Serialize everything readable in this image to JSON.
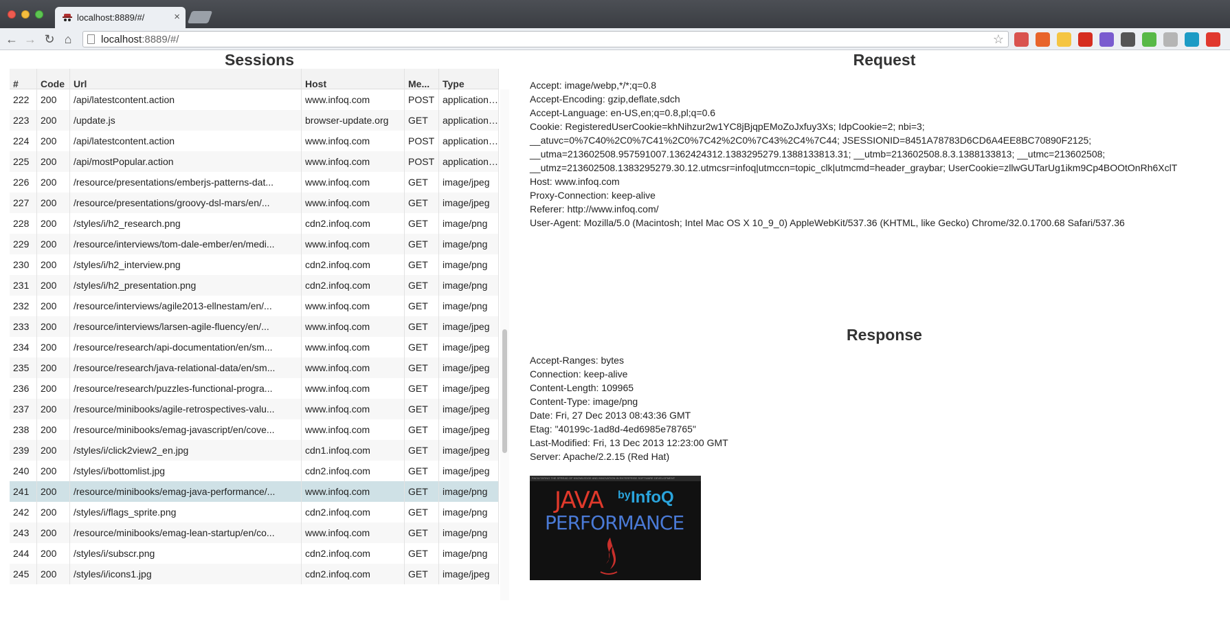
{
  "browser": {
    "tab_title": "localhost:8889/#/",
    "tab_close": "×",
    "url_host": "localhost",
    "url_rest": ":8889/#/",
    "back": "←",
    "forward": "→",
    "reload": "↻",
    "home": "⌂",
    "star": "☆",
    "extensions": [
      {
        "name": "bookmark-ext-icon",
        "color": "#d9534f"
      },
      {
        "name": "firebug-ext-icon",
        "color": "#e8642b"
      },
      {
        "name": "star-ext-icon",
        "color": "#f5c542"
      },
      {
        "name": "power-ext-icon",
        "color": "#d62d20"
      },
      {
        "name": "grid-ext-icon",
        "color": "#7a5ccf"
      },
      {
        "name": "pocket-ext-icon",
        "color": "#555555"
      },
      {
        "name": "evernote-ext-icon",
        "color": "#58b947"
      },
      {
        "name": "android-ext-icon",
        "color": "#b5b5b5"
      },
      {
        "name": "feed-ext-icon",
        "color": "#1d9bc5"
      },
      {
        "name": "adblock-ext-icon",
        "color": "#e0382e"
      }
    ]
  },
  "sessions": {
    "title": "Sessions",
    "columns": [
      "#",
      "Code",
      "Url",
      "Host",
      "Me...",
      "Type"
    ],
    "selected": "241",
    "rows": [
      [
        "222",
        "200",
        "/api/latestcontent.action",
        "www.infoq.com",
        "POST",
        "application/..."
      ],
      [
        "223",
        "200",
        "/update.js",
        "browser-update.org",
        "GET",
        "application/..."
      ],
      [
        "224",
        "200",
        "/api/latestcontent.action",
        "www.infoq.com",
        "POST",
        "application/..."
      ],
      [
        "225",
        "200",
        "/api/mostPopular.action",
        "www.infoq.com",
        "POST",
        "application/..."
      ],
      [
        "226",
        "200",
        "/resource/presentations/emberjs-patterns-dat...",
        "www.infoq.com",
        "GET",
        "image/jpeg"
      ],
      [
        "227",
        "200",
        "/resource/presentations/groovy-dsl-mars/en/...",
        "www.infoq.com",
        "GET",
        "image/jpeg"
      ],
      [
        "228",
        "200",
        "/styles/i/h2_research.png",
        "cdn2.infoq.com",
        "GET",
        "image/png"
      ],
      [
        "229",
        "200",
        "/resource/interviews/tom-dale-ember/en/medi...",
        "www.infoq.com",
        "GET",
        "image/png"
      ],
      [
        "230",
        "200",
        "/styles/i/h2_interview.png",
        "cdn2.infoq.com",
        "GET",
        "image/png"
      ],
      [
        "231",
        "200",
        "/styles/i/h2_presentation.png",
        "cdn2.infoq.com",
        "GET",
        "image/png"
      ],
      [
        "232",
        "200",
        "/resource/interviews/agile2013-ellnestam/en/...",
        "www.infoq.com",
        "GET",
        "image/png"
      ],
      [
        "233",
        "200",
        "/resource/interviews/larsen-agile-fluency/en/...",
        "www.infoq.com",
        "GET",
        "image/jpeg"
      ],
      [
        "234",
        "200",
        "/resource/research/api-documentation/en/sm...",
        "www.infoq.com",
        "GET",
        "image/jpeg"
      ],
      [
        "235",
        "200",
        "/resource/research/java-relational-data/en/sm...",
        "www.infoq.com",
        "GET",
        "image/jpeg"
      ],
      [
        "236",
        "200",
        "/resource/research/puzzles-functional-progra...",
        "www.infoq.com",
        "GET",
        "image/jpeg"
      ],
      [
        "237",
        "200",
        "/resource/minibooks/agile-retrospectives-valu...",
        "www.infoq.com",
        "GET",
        "image/jpeg"
      ],
      [
        "238",
        "200",
        "/resource/minibooks/emag-javascript/en/cove...",
        "www.infoq.com",
        "GET",
        "image/jpeg"
      ],
      [
        "239",
        "200",
        "/styles/i/click2view2_en.jpg",
        "cdn1.infoq.com",
        "GET",
        "image/jpeg"
      ],
      [
        "240",
        "200",
        "/styles/i/bottomlist.jpg",
        "cdn2.infoq.com",
        "GET",
        "image/jpeg"
      ],
      [
        "241",
        "200",
        "/resource/minibooks/emag-java-performance/...",
        "www.infoq.com",
        "GET",
        "image/png"
      ],
      [
        "242",
        "200",
        "/styles/i/flags_sprite.png",
        "cdn2.infoq.com",
        "GET",
        "image/png"
      ],
      [
        "243",
        "200",
        "/resource/minibooks/emag-lean-startup/en/co...",
        "www.infoq.com",
        "GET",
        "image/png"
      ],
      [
        "244",
        "200",
        "/styles/i/subscr.png",
        "cdn2.infoq.com",
        "GET",
        "image/png"
      ],
      [
        "245",
        "200",
        "/styles/i/icons1.jpg",
        "cdn2.infoq.com",
        "GET",
        "image/jpeg"
      ]
    ]
  },
  "request": {
    "title": "Request",
    "headers": [
      "Accept: image/webp,*/*;q=0.8",
      "Accept-Encoding: gzip,deflate,sdch",
      "Accept-Language: en-US,en;q=0.8,pl;q=0.6",
      "Cookie: RegisteredUserCookie=khNihzur2w1YC8jBjqpEMoZoJxfuy3Xs; IdpCookie=2; nbi=3;",
      "__atuvc=0%7C40%2C0%7C41%2C0%7C42%2C0%7C43%2C4%7C44; JSESSIONID=8451A78783D6CD6A4EE8BC70890F2125;",
      "__utma=213602508.957591007.1362424312.1383295279.1388133813.31; __utmb=213602508.8.3.1388133813; __utmc=213602508;",
      "__utmz=213602508.1383295279.30.12.utmcsr=infoq|utmccn=topic_clk|utmcmd=header_graybar; UserCookie=zllwGUTarUg1ikm9Cp4BOOtOnRh6XclT",
      "Host: www.infoq.com",
      "Proxy-Connection: keep-alive",
      "Referer: http://www.infoq.com/",
      "User-Agent: Mozilla/5.0 (Macintosh; Intel Mac OS X 10_9_0) AppleWebKit/537.36 (KHTML, like Gecko) Chrome/32.0.1700.68 Safari/537.36"
    ]
  },
  "response": {
    "title": "Response",
    "headers": [
      "Accept-Ranges: bytes",
      "Connection: keep-alive",
      "Content-Length: 109965",
      "Content-Type: image/png",
      "Date: Fri, 27 Dec 2013 08:43:36 GMT",
      "Etag: \"40199c-1ad8d-4ed6985e78765\"",
      "Last-Modified: Fri, 13 Dec 2013 12:23:00 GMT",
      "Server: Apache/2.2.15 (Red Hat)"
    ],
    "preview": {
      "strip": "FACILITATING THE SPREAD OF KNOWLEDGE AND INNOVATION IN ENTERPRISE SOFTWARE DEVELOPMENT",
      "word1": "JAVA",
      "by": "by",
      "brand": "InfoQ",
      "word2": "PERFORMANCE"
    }
  }
}
